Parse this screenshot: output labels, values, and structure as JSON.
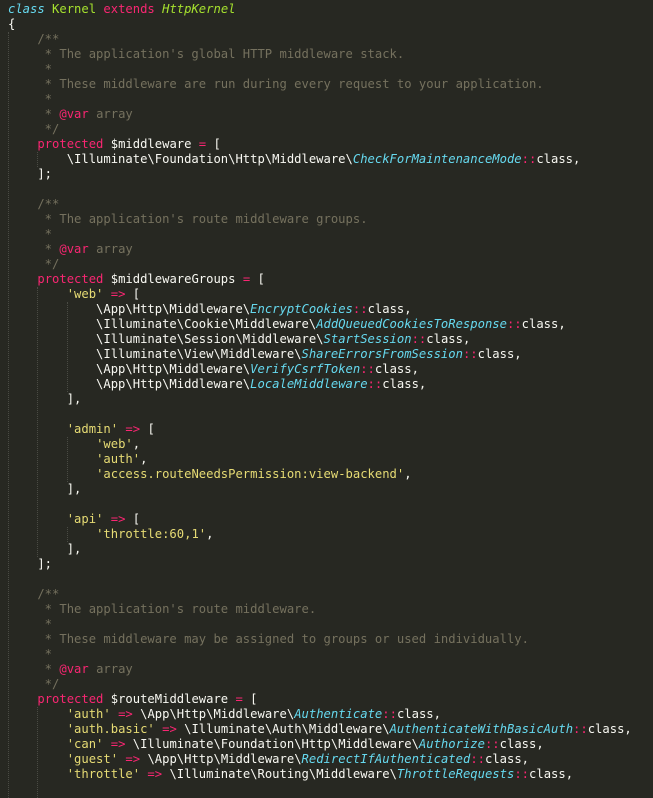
{
  "editor": {
    "theme_colors": {
      "background": "#272822",
      "foreground": "#f8f8f2",
      "keyword": "#f92672",
      "storage_type": "#66d9ef",
      "class_name": "#a6e22e",
      "comment": "#75715e",
      "string": "#e6db74"
    },
    "lines": [
      [
        [
          "t-storage",
          "class"
        ],
        [
          "t-plain",
          " "
        ],
        [
          "t-class",
          "Kernel"
        ],
        [
          "t-plain",
          " "
        ],
        [
          "t-kw",
          "extends"
        ],
        [
          "t-plain",
          " "
        ],
        [
          "t-inherit",
          "HttpKernel"
        ]
      ],
      [
        [
          "t-plain",
          "{"
        ]
      ],
      [
        [
          "t-comment",
          "    /**"
        ]
      ],
      [
        [
          "t-comment",
          "     * The application's global HTTP middleware stack."
        ]
      ],
      [
        [
          "t-comment",
          "     *"
        ]
      ],
      [
        [
          "t-comment",
          "     * These middleware are run during every request to your application."
        ]
      ],
      [
        [
          "t-comment",
          "     *"
        ]
      ],
      [
        [
          "t-comment",
          "     * "
        ],
        [
          "t-tag",
          "@var"
        ],
        [
          "t-comment",
          " array"
        ]
      ],
      [
        [
          "t-comment",
          "     */"
        ]
      ],
      [
        [
          "t-plain",
          "    "
        ],
        [
          "t-kw",
          "protected"
        ],
        [
          "t-plain",
          " $middleware "
        ],
        [
          "t-kw",
          "="
        ],
        [
          "t-plain",
          " ["
        ]
      ],
      [
        [
          "t-plain",
          "        \\Illuminate\\Foundation\\Http\\Middleware\\"
        ],
        [
          "t-cls",
          "CheckForMaintenanceMode"
        ],
        [
          "t-kw",
          "::"
        ],
        [
          "t-plain",
          "class,"
        ]
      ],
      [
        [
          "t-plain",
          "    ];"
        ]
      ],
      [
        [
          "t-plain",
          ""
        ]
      ],
      [
        [
          "t-comment",
          "    /**"
        ]
      ],
      [
        [
          "t-comment",
          "     * The application's route middleware groups."
        ]
      ],
      [
        [
          "t-comment",
          "     *"
        ]
      ],
      [
        [
          "t-comment",
          "     * "
        ],
        [
          "t-tag",
          "@var"
        ],
        [
          "t-comment",
          " array"
        ]
      ],
      [
        [
          "t-comment",
          "     */"
        ]
      ],
      [
        [
          "t-plain",
          "    "
        ],
        [
          "t-kw",
          "protected"
        ],
        [
          "t-plain",
          " $middlewareGroups "
        ],
        [
          "t-kw",
          "="
        ],
        [
          "t-plain",
          " ["
        ]
      ],
      [
        [
          "t-plain",
          "        "
        ],
        [
          "t-str",
          "'web'"
        ],
        [
          "t-plain",
          " "
        ],
        [
          "t-kw",
          "=>"
        ],
        [
          "t-plain",
          " ["
        ]
      ],
      [
        [
          "t-plain",
          "            \\App\\Http\\Middleware\\"
        ],
        [
          "t-cls",
          "EncryptCookies"
        ],
        [
          "t-kw",
          "::"
        ],
        [
          "t-plain",
          "class,"
        ]
      ],
      [
        [
          "t-plain",
          "            \\Illuminate\\Cookie\\Middleware\\"
        ],
        [
          "t-cls",
          "AddQueuedCookiesToResponse"
        ],
        [
          "t-kw",
          "::"
        ],
        [
          "t-plain",
          "class,"
        ]
      ],
      [
        [
          "t-plain",
          "            \\Illuminate\\Session\\Middleware\\"
        ],
        [
          "t-cls",
          "StartSession"
        ],
        [
          "t-kw",
          "::"
        ],
        [
          "t-plain",
          "class,"
        ]
      ],
      [
        [
          "t-plain",
          "            \\Illuminate\\View\\Middleware\\"
        ],
        [
          "t-cls",
          "ShareErrorsFromSession"
        ],
        [
          "t-kw",
          "::"
        ],
        [
          "t-plain",
          "class,"
        ]
      ],
      [
        [
          "t-plain",
          "            \\App\\Http\\Middleware\\"
        ],
        [
          "t-cls",
          "VerifyCsrfToken"
        ],
        [
          "t-kw",
          "::"
        ],
        [
          "t-plain",
          "class,"
        ]
      ],
      [
        [
          "t-plain",
          "            \\App\\Http\\Middleware\\"
        ],
        [
          "t-cls",
          "LocaleMiddleware"
        ],
        [
          "t-kw",
          "::"
        ],
        [
          "t-plain",
          "class,"
        ]
      ],
      [
        [
          "t-plain",
          "        ],"
        ]
      ],
      [
        [
          "t-plain",
          ""
        ]
      ],
      [
        [
          "t-plain",
          "        "
        ],
        [
          "t-str",
          "'admin'"
        ],
        [
          "t-plain",
          " "
        ],
        [
          "t-kw",
          "=>"
        ],
        [
          "t-plain",
          " ["
        ]
      ],
      [
        [
          "t-plain",
          "            "
        ],
        [
          "t-str",
          "'web'"
        ],
        [
          "t-plain",
          ","
        ]
      ],
      [
        [
          "t-plain",
          "            "
        ],
        [
          "t-str",
          "'auth'"
        ],
        [
          "t-plain",
          ","
        ]
      ],
      [
        [
          "t-plain",
          "            "
        ],
        [
          "t-str",
          "'access.routeNeedsPermission:view-backend'"
        ],
        [
          "t-plain",
          ","
        ]
      ],
      [
        [
          "t-plain",
          "        ],"
        ]
      ],
      [
        [
          "t-plain",
          ""
        ]
      ],
      [
        [
          "t-plain",
          "        "
        ],
        [
          "t-str",
          "'api'"
        ],
        [
          "t-plain",
          " "
        ],
        [
          "t-kw",
          "=>"
        ],
        [
          "t-plain",
          " ["
        ]
      ],
      [
        [
          "t-plain",
          "            "
        ],
        [
          "t-str",
          "'throttle:60,1'"
        ],
        [
          "t-plain",
          ","
        ]
      ],
      [
        [
          "t-plain",
          "        ],"
        ]
      ],
      [
        [
          "t-plain",
          "    ];"
        ]
      ],
      [
        [
          "t-plain",
          ""
        ]
      ],
      [
        [
          "t-comment",
          "    /**"
        ]
      ],
      [
        [
          "t-comment",
          "     * The application's route middleware."
        ]
      ],
      [
        [
          "t-comment",
          "     *"
        ]
      ],
      [
        [
          "t-comment",
          "     * These middleware may be assigned to groups or used individually."
        ]
      ],
      [
        [
          "t-comment",
          "     *"
        ]
      ],
      [
        [
          "t-comment",
          "     * "
        ],
        [
          "t-tag",
          "@var"
        ],
        [
          "t-comment",
          " array"
        ]
      ],
      [
        [
          "t-comment",
          "     */"
        ]
      ],
      [
        [
          "t-plain",
          "    "
        ],
        [
          "t-kw",
          "protected"
        ],
        [
          "t-plain",
          " $routeMiddleware "
        ],
        [
          "t-kw",
          "="
        ],
        [
          "t-plain",
          " ["
        ]
      ],
      [
        [
          "t-plain",
          "        "
        ],
        [
          "t-str",
          "'auth'"
        ],
        [
          "t-plain",
          " "
        ],
        [
          "t-kw",
          "=>"
        ],
        [
          "t-plain",
          " \\App\\Http\\Middleware\\"
        ],
        [
          "t-cls",
          "Authenticate"
        ],
        [
          "t-kw",
          "::"
        ],
        [
          "t-plain",
          "class,"
        ]
      ],
      [
        [
          "t-plain",
          "        "
        ],
        [
          "t-str",
          "'auth.basic'"
        ],
        [
          "t-plain",
          " "
        ],
        [
          "t-kw",
          "=>"
        ],
        [
          "t-plain",
          " \\Illuminate\\Auth\\Middleware\\"
        ],
        [
          "t-cls",
          "AuthenticateWithBasicAuth"
        ],
        [
          "t-kw",
          "::"
        ],
        [
          "t-plain",
          "class,"
        ]
      ],
      [
        [
          "t-plain",
          "        "
        ],
        [
          "t-str",
          "'can'"
        ],
        [
          "t-plain",
          " "
        ],
        [
          "t-kw",
          "=>"
        ],
        [
          "t-plain",
          " \\Illuminate\\Foundation\\Http\\Middleware\\"
        ],
        [
          "t-cls",
          "Authorize"
        ],
        [
          "t-kw",
          "::"
        ],
        [
          "t-plain",
          "class,"
        ]
      ],
      [
        [
          "t-plain",
          "        "
        ],
        [
          "t-str",
          "'guest'"
        ],
        [
          "t-plain",
          " "
        ],
        [
          "t-kw",
          "=>"
        ],
        [
          "t-plain",
          " \\App\\Http\\Middleware\\"
        ],
        [
          "t-cls",
          "RedirectIfAuthenticated"
        ],
        [
          "t-kw",
          "::"
        ],
        [
          "t-plain",
          "class,"
        ]
      ],
      [
        [
          "t-plain",
          "        "
        ],
        [
          "t-str",
          "'throttle'"
        ],
        [
          "t-plain",
          " "
        ],
        [
          "t-kw",
          "=>"
        ],
        [
          "t-plain",
          " \\Illuminate\\Routing\\Middleware\\"
        ],
        [
          "t-cls",
          "ThrottleRequests"
        ],
        [
          "t-kw",
          "::"
        ],
        [
          "t-plain",
          "class,"
        ]
      ]
    ]
  }
}
